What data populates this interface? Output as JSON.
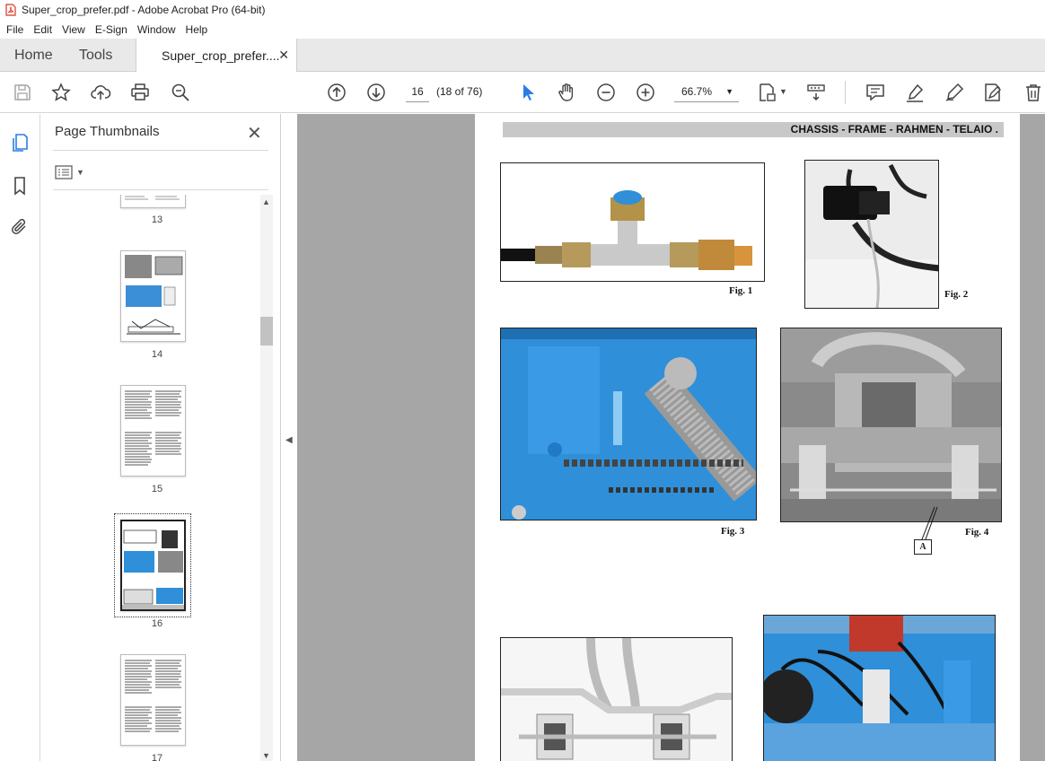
{
  "window": {
    "title": "Super_crop_prefer.pdf - Adobe Acrobat Pro (64-bit)"
  },
  "menu": [
    "File",
    "Edit",
    "View",
    "E-Sign",
    "Window",
    "Help"
  ],
  "tabs": {
    "home": "Home",
    "tools": "Tools",
    "doc": "Super_crop_prefer...."
  },
  "toolbar": {
    "page_current": "16",
    "page_count": "(18 of 76)",
    "zoom": "66.7%"
  },
  "panel": {
    "title": "Page Thumbnails",
    "thumbnails": [
      {
        "label": "13"
      },
      {
        "label": "14"
      },
      {
        "label": "15"
      },
      {
        "label": "16",
        "selected": true
      },
      {
        "label": "17"
      }
    ]
  },
  "page": {
    "header": "CHASSIS - FRAME - RAHMEN - TELAIO .",
    "captions": {
      "fig1": "Fig. 1",
      "fig2": "Fig. 2",
      "fig3": "Fig. 3",
      "fig4": "Fig. 4"
    },
    "callout_a": "A"
  },
  "colors": {
    "accent_blue": "#2a7de1",
    "machine_blue": "#2f8fd8",
    "doc_bg": "#a6a6a6"
  }
}
